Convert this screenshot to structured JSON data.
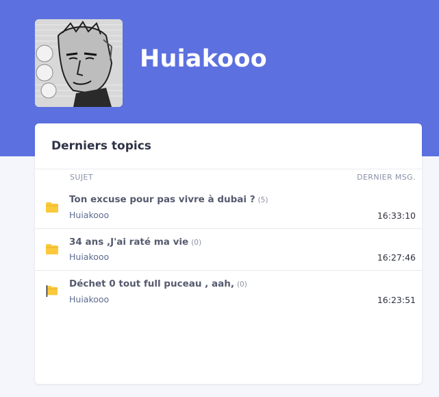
{
  "profile": {
    "username": "Huiakooo"
  },
  "topics_card": {
    "title": "Derniers topics",
    "columns": {
      "subject": "SUJET",
      "last_message": "DERNIER MSG."
    },
    "topics": [
      {
        "title": "Ton excuse pour pas vivre à dubai ?",
        "count": "(5)",
        "author": "Huiakooo",
        "time": "16:33:10",
        "icon": "folder-icon"
      },
      {
        "title": "34 ans ,J'ai raté ma vie",
        "count": "(0)",
        "author": "Huiakooo",
        "time": "16:27:46",
        "icon": "folder-icon"
      },
      {
        "title": "Déchet 0 tout full puceau , aah,",
        "count": "(0)",
        "author": "Huiakooo",
        "time": "16:23:51",
        "icon": "folder-pinned-icon"
      }
    ]
  },
  "colors": {
    "hero_background": "#5c70e0",
    "folder": "#fbc93b",
    "pin": "#222222"
  }
}
